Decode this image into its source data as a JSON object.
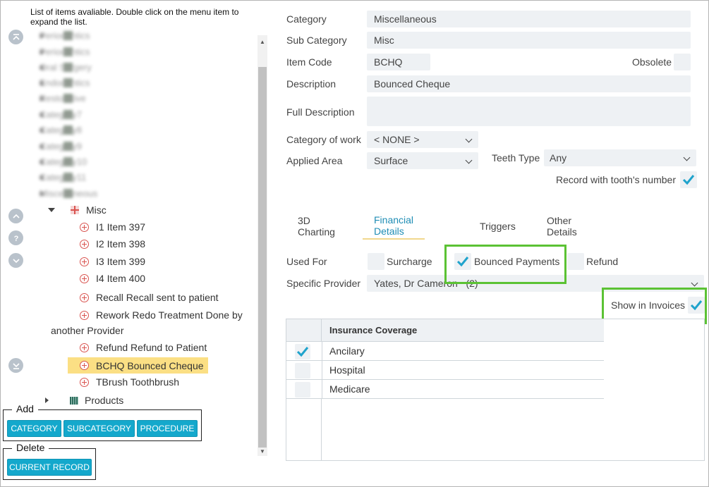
{
  "tree": {
    "instructions": "List of items avaliable. Double click on the menu item to expand the list.",
    "blurred_items": [
      "Periodontics",
      "Periodontics",
      "Oral Surgery",
      "Endodontics",
      "Restorative",
      "Category7",
      "Category8",
      "Category9",
      "Category10",
      "Category11",
      "Miscellaneous"
    ],
    "category": "Misc",
    "items": [
      "I1 Item 397",
      "I2 Item 398",
      "I3 Item 399",
      "I4 Item 400"
    ],
    "procedures": {
      "recall": "Recall Recall sent to patient",
      "rework_line1": "Rework Redo Treatment Done by",
      "rework_line2": "another Provider",
      "refund": "Refund Refund to Patient",
      "bchq": "BCHQ Bounced Cheque",
      "tbrush": "TBrush Toothbrush"
    },
    "products": "Products"
  },
  "add_group": {
    "title": "Add",
    "category_button": "CATEGORY",
    "subcategory_button": "SUBCATEGORY",
    "procedure_button": "PROCEDURE"
  },
  "delete_group": {
    "title": "Delete",
    "current_record_button": "CURRENT RECORD"
  },
  "form": {
    "category_label": "Category",
    "category_value": "Miscellaneous",
    "subcategory_label": "Sub Category",
    "subcategory_value": "Misc",
    "item_code_label": "Item Code",
    "item_code_value": "BCHQ",
    "obsolete_label": "Obsolete",
    "obsolete_checked": false,
    "description_label": "Description",
    "description_value": "Bounced Cheque",
    "full_description_label": "Full Description",
    "full_description_value": "",
    "category_of_work_label": "Category of work",
    "category_of_work_value": "< NONE >",
    "applied_area_label": "Applied Area",
    "applied_area_value": "Surface",
    "teeth_type_label": "Teeth Type",
    "teeth_type_value": "Any",
    "record_tooth_label": "Record with tooth's number",
    "record_tooth_checked": true
  },
  "tabs": [
    {
      "label": "3D Charting",
      "active": false
    },
    {
      "label": "Financial Details",
      "active": true
    },
    {
      "label": "Triggers",
      "active": false
    },
    {
      "label": "Other Details",
      "active": false
    }
  ],
  "financial": {
    "used_for_label": "Used For",
    "surcharge_label": "Surcharge",
    "surcharge_checked": false,
    "bounced_label": "Bounced Payments",
    "bounced_checked": true,
    "refund_label": "Refund",
    "refund_checked": false,
    "specific_provider_label": "Specific Provider",
    "specific_provider_value": "Yates, Dr Cameron   (2)",
    "show_invoices_label": "Show in Invoices",
    "show_invoices_checked": true
  },
  "insurance": {
    "header": "Insurance Coverage",
    "rows": [
      {
        "name": "Ancilary",
        "checked": true
      },
      {
        "name": "Hospital",
        "checked": false
      },
      {
        "name": "Medicare",
        "checked": false
      }
    ]
  },
  "colors": {
    "accent": "#14a8cc",
    "check": "#1fa3cc",
    "highlight": "#5bc234",
    "selected_row": "#fbdf84",
    "field_bg": "#eef1f4"
  }
}
